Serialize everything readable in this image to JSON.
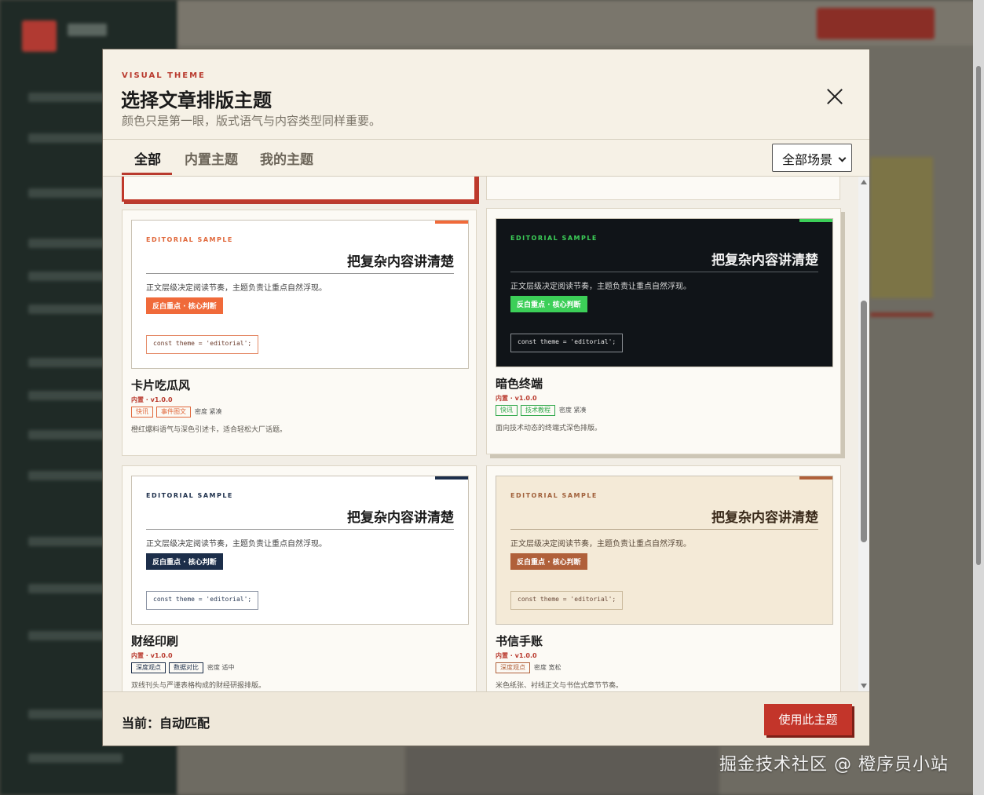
{
  "modal": {
    "eyebrow": "VISUAL THEME",
    "title": "选择文章排版主题",
    "subtitle": "颜色只是第一眼，版式语气与内容类型同样重要。"
  },
  "tabs": [
    {
      "label": "全部",
      "active": true
    },
    {
      "label": "内置主题",
      "active": false
    },
    {
      "label": "我的主题",
      "active": false
    }
  ],
  "filter": {
    "selected": "全部场景"
  },
  "preview_text": {
    "eyebrow": "EDITORIAL SAMPLE",
    "headline": "把复杂内容讲清楚",
    "body": "正文层级决定阅读节奏，主题负责让重点自然浮现。",
    "badge": "反白重点 · 核心判断",
    "code": "const theme = 'editorial';"
  },
  "themes": [
    {
      "name": "卡片吃瓜风",
      "meta": "内置 · v1.0.0",
      "tags": [
        "快讯",
        "事件图文"
      ],
      "density": "密度 紧凑",
      "desc": "橙红爆料语气与深色引述卡，适合轻松大厂话题。",
      "colors": {
        "bg": "#ffffff",
        "accent": "#f06a3a",
        "title": "#1a1a1a",
        "text": "#444444",
        "rule": "#999999",
        "eyebrow": "#e0673a",
        "codeBorder": "#e58c6a",
        "codeText": "#6a3a2a",
        "tag": "#e0673a"
      }
    },
    {
      "name": "暗色终端",
      "meta": "内置 · v1.0.0",
      "tags": [
        "快讯",
        "技术教程"
      ],
      "density": "密度 紧凑",
      "desc": "面向技术动态的终端式深色排版。",
      "colors": {
        "bg": "#101418",
        "accent": "#3ccf58",
        "title": "#f2f2f2",
        "text": "#d8d8d8",
        "rule": "#5a5f64",
        "eyebrow": "#3ccf58",
        "codeBorder": "#8a8f94",
        "codeText": "#e6e6e6",
        "tag": "#2fa84a"
      }
    },
    {
      "name": "财经印刷",
      "meta": "内置 · v1.0.0",
      "tags": [
        "深度观点",
        "数据对比"
      ],
      "density": "密度 适中",
      "desc": "双线刊头与严谨表格构成的财经研报排版。",
      "colors": {
        "bg": "#ffffff",
        "accent": "#1c2e4a",
        "title": "#1a1a1a",
        "text": "#444444",
        "rule": "#999999",
        "eyebrow": "#1c2e4a",
        "codeBorder": "#8a93a3",
        "codeText": "#2a3a55",
        "tag": "#1c2e4a"
      }
    },
    {
      "name": "书信手账",
      "meta": "内置 · v1.0.0",
      "tags": [
        "深度观点"
      ],
      "density": "密度 宽松",
      "desc": "米色纸张、衬线正文与书信式章节节奏。",
      "colors": {
        "bg": "#f4ead7",
        "accent": "#b0603a",
        "title": "#3a2a1a",
        "text": "#5a4a3a",
        "rule": "#b9a98f",
        "eyebrow": "#a0603a",
        "codeBorder": "#c9b89a",
        "codeText": "#6a4a3a",
        "tag": "#b0603a"
      }
    }
  ],
  "footer": {
    "current": "当前：自动匹配",
    "use_button": "使用此主题"
  },
  "watermark": "掘金技术社区 @ 橙序员小站"
}
